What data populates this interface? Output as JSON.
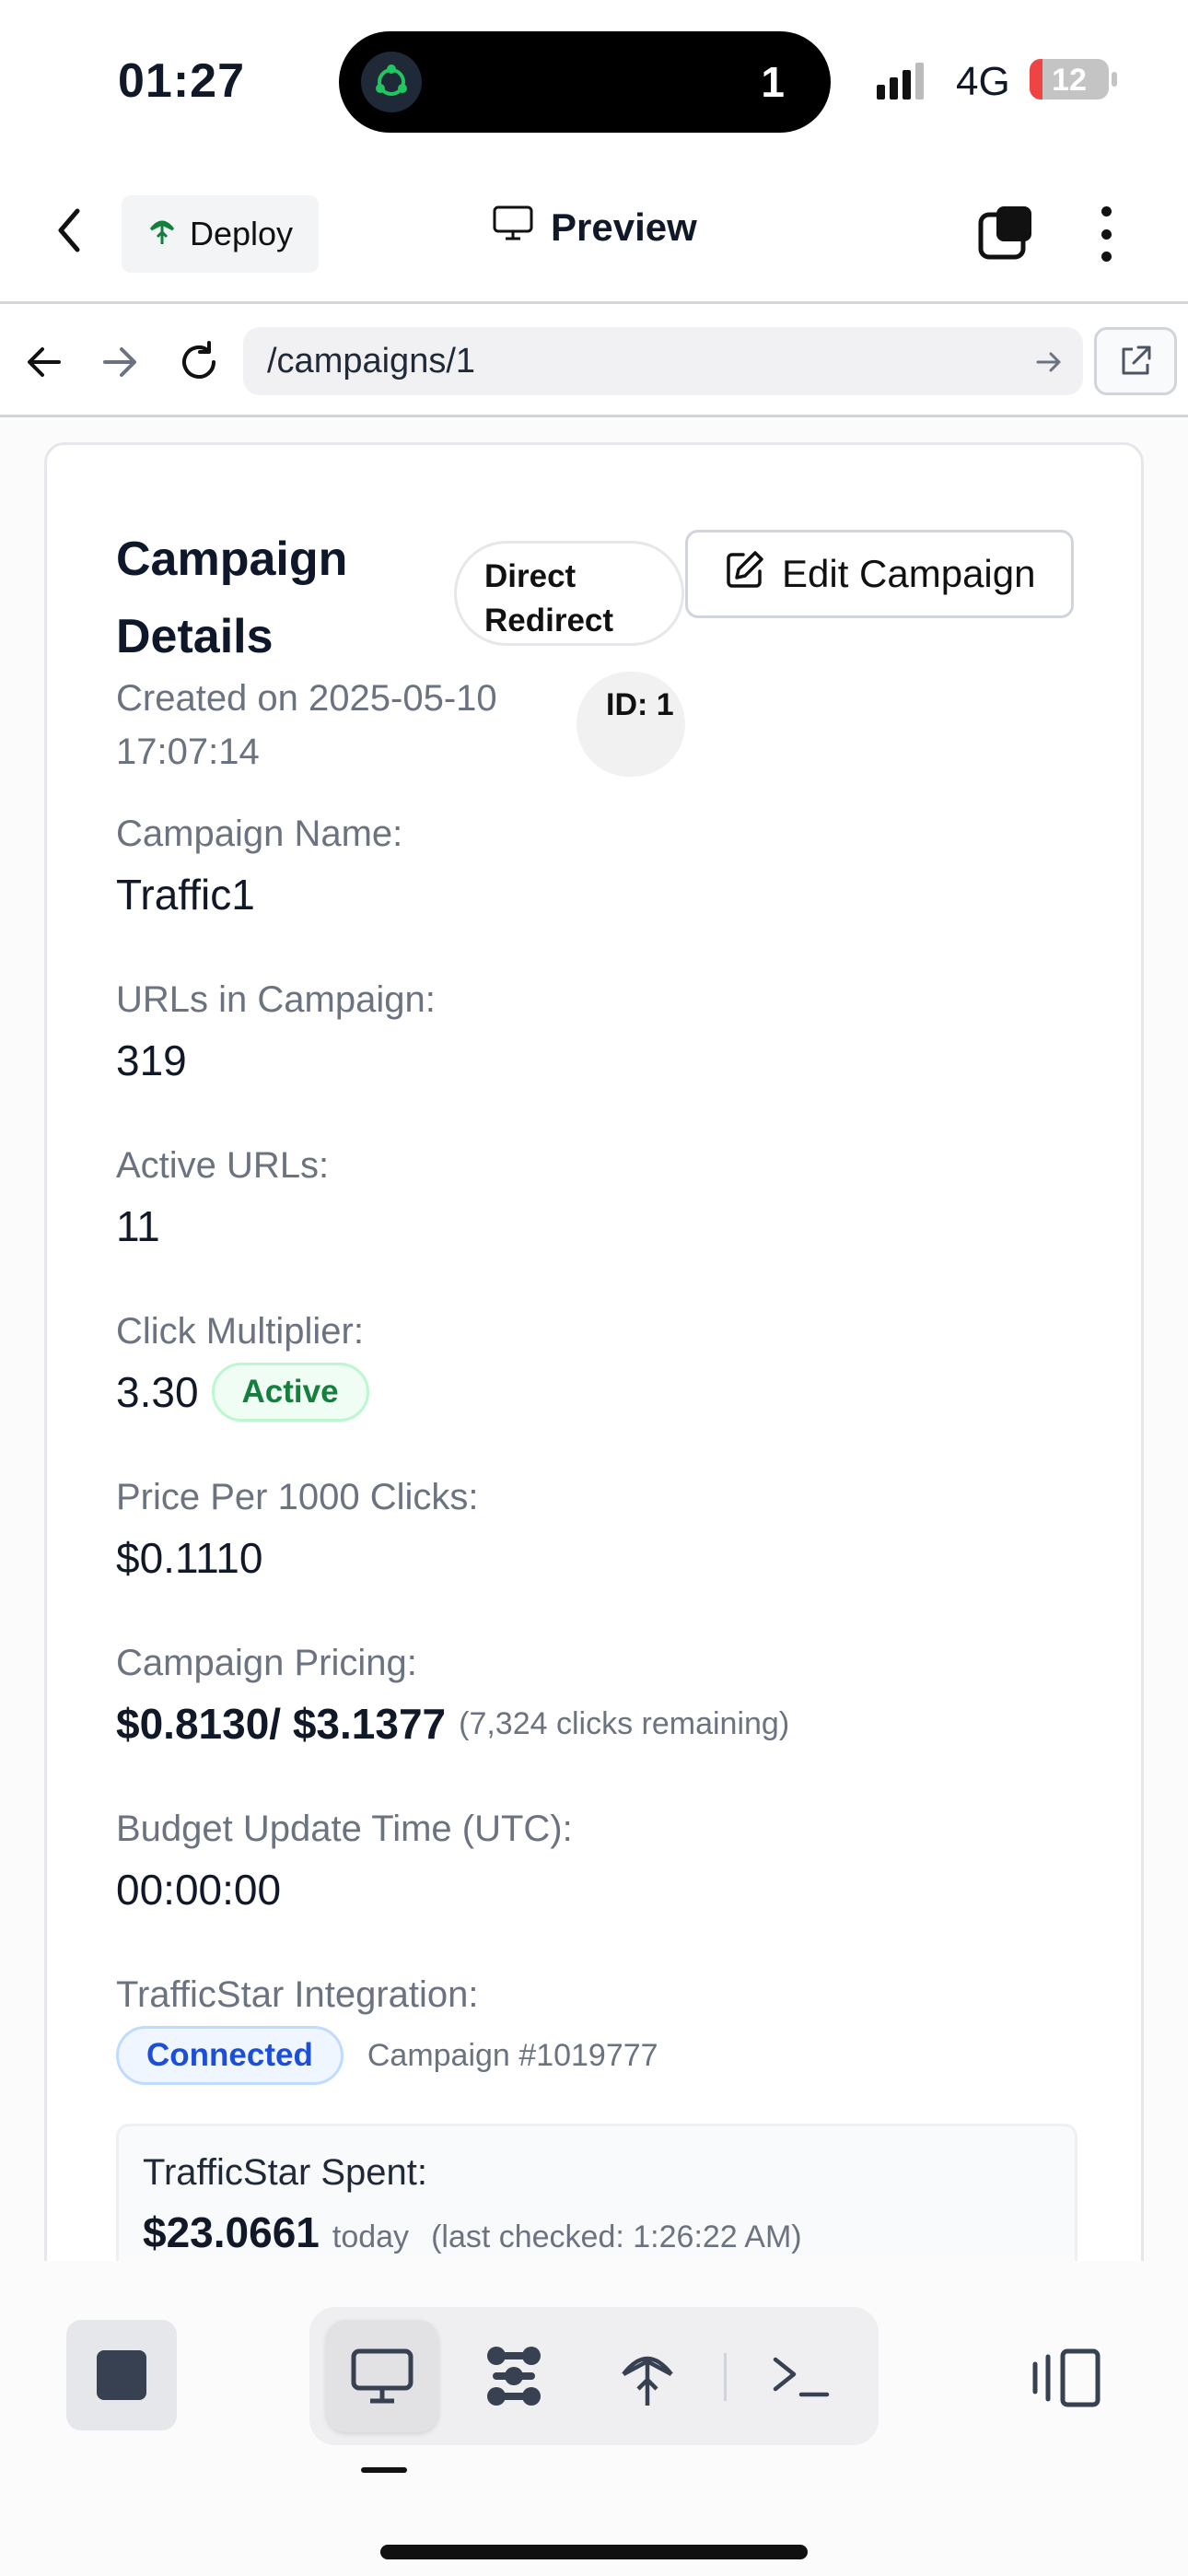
{
  "status_bar": {
    "time": "01:27",
    "island_count": "1",
    "network": "4G",
    "battery": "12"
  },
  "app_header": {
    "deploy_label": "Deploy",
    "preview_label": "Preview"
  },
  "url_bar": {
    "url": "/campaigns/1"
  },
  "campaign": {
    "title": "Campaign Details",
    "type_badge": "Direct Redirect",
    "edit_label": "Edit Campaign",
    "created": "Created on 2025-05-10 17:07:14",
    "id_badge": "ID: 1",
    "fields": {
      "name_label": "Campaign Name:",
      "name_value": "Traffic1",
      "urls_label": "URLs in Campaign:",
      "urls_value": "319",
      "active_label": "Active URLs:",
      "active_value": "11",
      "multiplier_label": "Click Multiplier:",
      "multiplier_value": "3.30",
      "multiplier_status": "Active",
      "price_label": "Price Per 1000 Clicks:",
      "price_value": "$0.1110",
      "pricing_label": "Campaign Pricing:",
      "pricing_value": "$0.8130/ $3.1377",
      "pricing_remaining": "(7,324 clicks remaining)",
      "budget_label": "Budget Update Time (UTC):",
      "budget_value": "00:00:00",
      "integration_label": "TrafficStar Integration:",
      "integration_status": "Connected",
      "integration_campaign": "Campaign #1019777"
    },
    "spent": {
      "label": "TrafficStar Spent:",
      "value": "$23.0661",
      "period": "today",
      "checked": "(last checked: 1:26:22 AM)"
    }
  },
  "icons": {
    "back": "chevron-left-icon",
    "deploy": "deploy-icon",
    "preview": "monitor-icon",
    "tabs": "tabs-icon",
    "more": "kebab-icon",
    "nav_back": "arrow-left-icon",
    "nav_forward": "arrow-right-icon",
    "reload": "reload-icon",
    "go": "arrow-right-icon",
    "open_external": "external-link-icon",
    "edit": "edit-icon",
    "stop": "stop-icon",
    "desktop": "desktop-icon",
    "nodes": "nodes-icon",
    "deploy_tool": "deploy-icon",
    "terminal": "terminal-icon",
    "side_panel": "side-panel-icon"
  },
  "colors": {
    "success": "#15803d",
    "info": "#1d4ed8",
    "muted": "#6b7280"
  }
}
